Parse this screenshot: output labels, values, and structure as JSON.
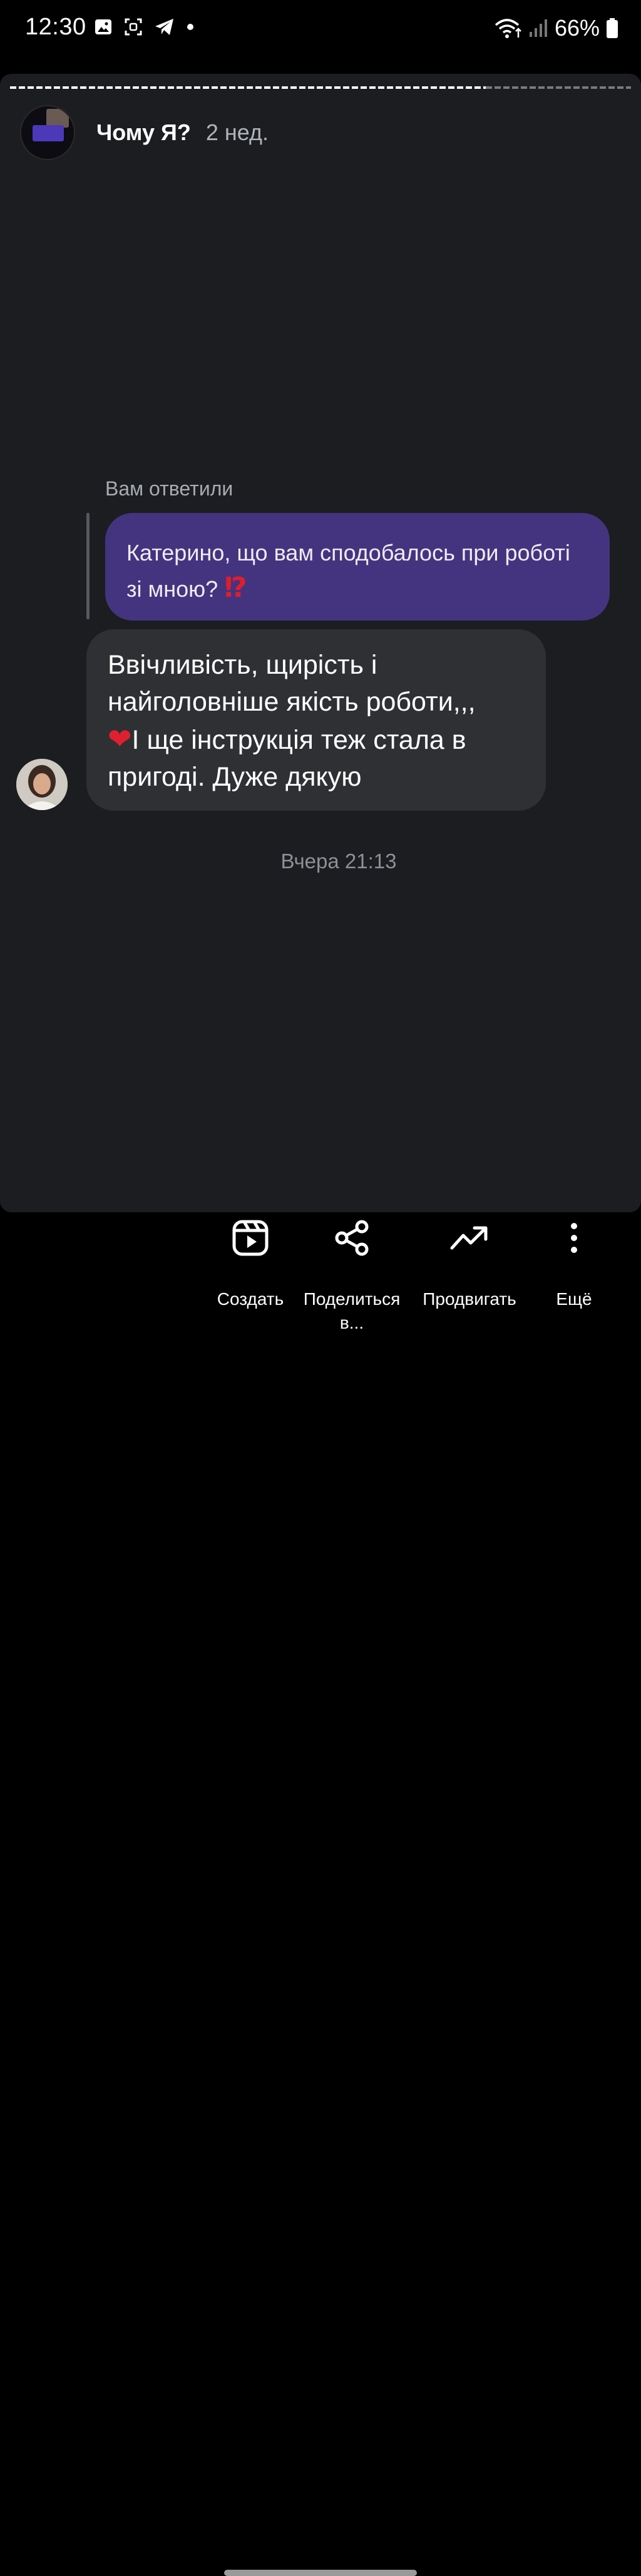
{
  "status_bar": {
    "time": "12:30",
    "battery": "66%",
    "icons_left": [
      "gallery-icon",
      "screenshot-icon",
      "telegram-icon",
      "dot-icon"
    ],
    "icons_right": [
      "wifi-icon",
      "signal-icon",
      "battery-icon"
    ]
  },
  "story": {
    "title": "Чому Я?",
    "time_ago": "2 нед."
  },
  "reply": {
    "caption": "Вам ответили",
    "quoted_message": "Катерино, що вам сподобалось при роботі зі мною?",
    "quoted_emoji": "⁉",
    "response_line1": "Ввічливість, щирість і",
    "response_line2": "найголовніше якість роботи,,,",
    "response_heart": "❤",
    "response_line3": "І ще інструкція теж стала в",
    "response_line4": "пригоді. Дуже дякую",
    "timestamp": "Вчера 21:13"
  },
  "actions": {
    "create_label": "Создать",
    "share_label_line1": "Поделиться",
    "share_label_line2": "в...",
    "promote_label": "Продвигать",
    "more_label": "Ещё"
  }
}
